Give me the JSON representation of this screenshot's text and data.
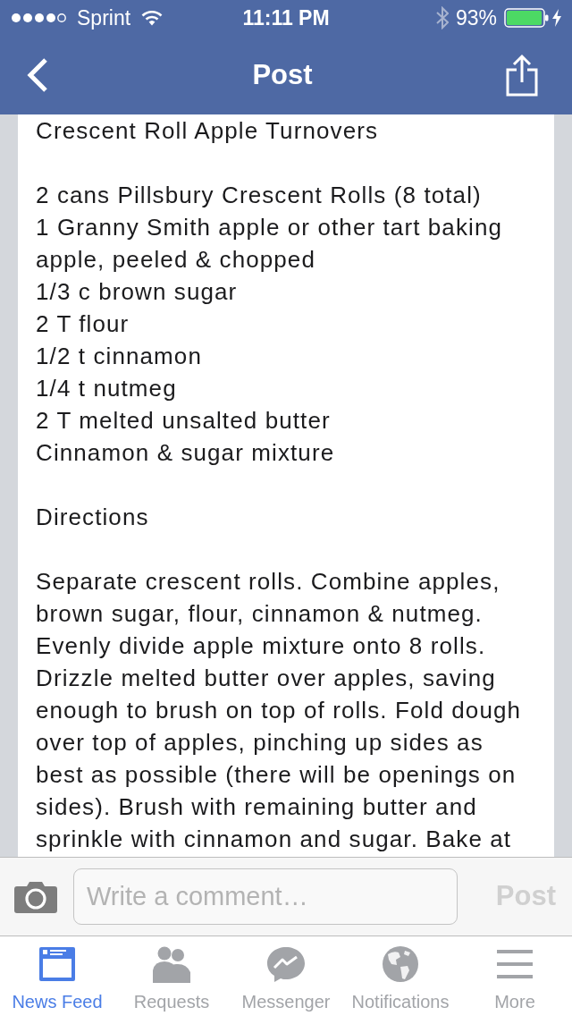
{
  "status_bar": {
    "carrier": "Sprint",
    "time": "11:11 PM",
    "battery": "93%"
  },
  "nav_bar": {
    "title": "Post"
  },
  "post": {
    "title": "Crescent Roll Apple Turnovers",
    "ingredients": [
      "2 cans Pillsbury Crescent Rolls (8 total)",
      "1 Granny Smith apple or other tart baking apple, peeled & chopped",
      "1/3 c brown sugar",
      "2 T flour",
      "1/2 t cinnamon",
      "1/4 t nutmeg",
      "2 T melted unsalted butter",
      "Cinnamon & sugar mixture"
    ],
    "directions_heading": "Directions",
    "directions": "Separate crescent rolls. Combine apples, brown sugar, flour, cinnamon & nutmeg. Evenly divide apple mixture onto 8 rolls. Drizzle melted butter over apples, saving enough to brush on top of rolls. Fold dough over top of apples, pinching up sides as best as possible (there will be openings on sides). Brush with remaining butter and sprinkle with cinnamon and sugar. Bake at"
  },
  "comment_bar": {
    "placeholder": "Write a comment…",
    "post_button": {
      "label": "Post",
      "disabled": true
    }
  },
  "tab_bar": [
    {
      "kind": "news-feed",
      "label": "News Feed",
      "selected": true
    },
    {
      "kind": "requests",
      "label": "Requests",
      "selected": false
    },
    {
      "kind": "messenger",
      "label": "Messenger",
      "selected": false
    },
    {
      "kind": "notifications",
      "label": "Notifications",
      "selected": false
    },
    {
      "kind": "more",
      "label": "More",
      "selected": false
    }
  ]
}
